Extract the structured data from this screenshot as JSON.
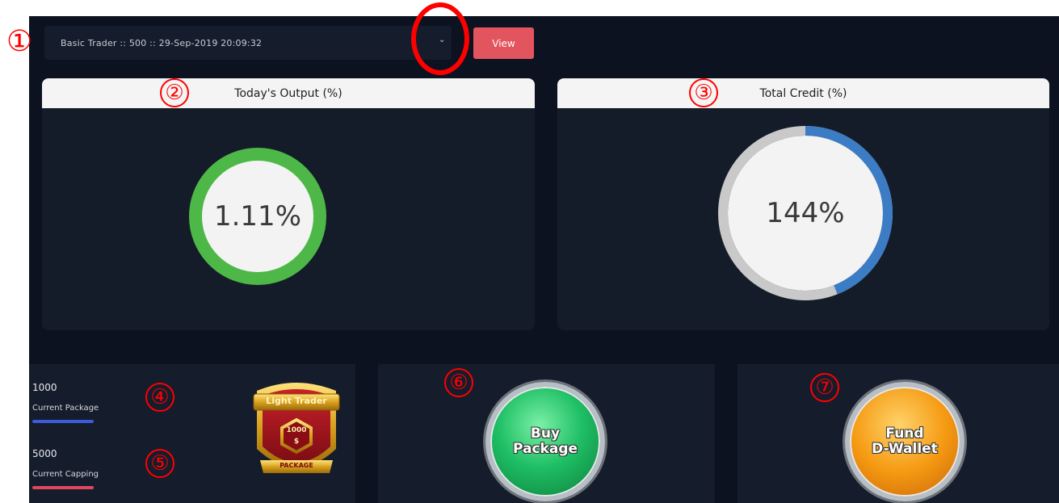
{
  "selector": {
    "value": "Basic Trader :: 500 :: 29-Sep-2019 20:09:32"
  },
  "view_button": {
    "label": "View"
  },
  "output_card": {
    "title": "Today's Output (%)",
    "value_text": "1.11%",
    "fill_fraction": 1.0,
    "ring_color": "#4db847"
  },
  "credit_card": {
    "title": "Total Credit (%)",
    "value_text": "144%",
    "fill_fraction": 0.44,
    "ring_color": "#3b7cc4",
    "track_color": "#c9c9c9"
  },
  "stats": {
    "package": {
      "value": "1000",
      "label": "Current Package",
      "bar_color": "#3b5bdb"
    },
    "capping": {
      "value": "5000",
      "label": "Current Capping",
      "bar_color": "#e0475f"
    }
  },
  "badge": {
    "title": "Light Trader",
    "amount": "1000",
    "currency": "$",
    "footer": "PACKAGE"
  },
  "buy_package": {
    "line1": "Buy",
    "line2": "Package"
  },
  "fund_wallet": {
    "line1": "Fund",
    "line2": "D-Wallet"
  },
  "annotations": [
    "①",
    "②",
    "③",
    "④",
    "⑤",
    "⑥",
    "⑦"
  ]
}
